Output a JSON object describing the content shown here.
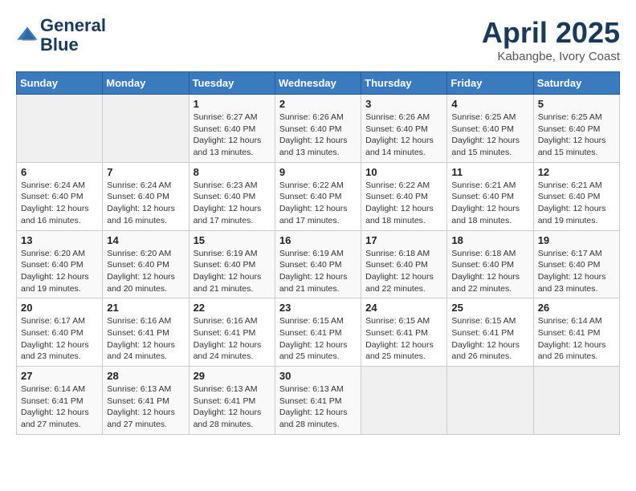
{
  "header": {
    "logo_line1": "General",
    "logo_line2": "Blue",
    "title": "April 2025",
    "subtitle": "Kabangbe, Ivory Coast"
  },
  "days_of_week": [
    "Sunday",
    "Monday",
    "Tuesday",
    "Wednesday",
    "Thursday",
    "Friday",
    "Saturday"
  ],
  "weeks": [
    [
      {
        "day": "",
        "sunrise": "",
        "sunset": "",
        "daylight": ""
      },
      {
        "day": "",
        "sunrise": "",
        "sunset": "",
        "daylight": ""
      },
      {
        "day": "1",
        "sunrise": "Sunrise: 6:27 AM",
        "sunset": "Sunset: 6:40 PM",
        "daylight": "Daylight: 12 hours and 13 minutes."
      },
      {
        "day": "2",
        "sunrise": "Sunrise: 6:26 AM",
        "sunset": "Sunset: 6:40 PM",
        "daylight": "Daylight: 12 hours and 13 minutes."
      },
      {
        "day": "3",
        "sunrise": "Sunrise: 6:26 AM",
        "sunset": "Sunset: 6:40 PM",
        "daylight": "Daylight: 12 hours and 14 minutes."
      },
      {
        "day": "4",
        "sunrise": "Sunrise: 6:25 AM",
        "sunset": "Sunset: 6:40 PM",
        "daylight": "Daylight: 12 hours and 15 minutes."
      },
      {
        "day": "5",
        "sunrise": "Sunrise: 6:25 AM",
        "sunset": "Sunset: 6:40 PM",
        "daylight": "Daylight: 12 hours and 15 minutes."
      }
    ],
    [
      {
        "day": "6",
        "sunrise": "Sunrise: 6:24 AM",
        "sunset": "Sunset: 6:40 PM",
        "daylight": "Daylight: 12 hours and 16 minutes."
      },
      {
        "day": "7",
        "sunrise": "Sunrise: 6:24 AM",
        "sunset": "Sunset: 6:40 PM",
        "daylight": "Daylight: 12 hours and 16 minutes."
      },
      {
        "day": "8",
        "sunrise": "Sunrise: 6:23 AM",
        "sunset": "Sunset: 6:40 PM",
        "daylight": "Daylight: 12 hours and 17 minutes."
      },
      {
        "day": "9",
        "sunrise": "Sunrise: 6:22 AM",
        "sunset": "Sunset: 6:40 PM",
        "daylight": "Daylight: 12 hours and 17 minutes."
      },
      {
        "day": "10",
        "sunrise": "Sunrise: 6:22 AM",
        "sunset": "Sunset: 6:40 PM",
        "daylight": "Daylight: 12 hours and 18 minutes."
      },
      {
        "day": "11",
        "sunrise": "Sunrise: 6:21 AM",
        "sunset": "Sunset: 6:40 PM",
        "daylight": "Daylight: 12 hours and 18 minutes."
      },
      {
        "day": "12",
        "sunrise": "Sunrise: 6:21 AM",
        "sunset": "Sunset: 6:40 PM",
        "daylight": "Daylight: 12 hours and 19 minutes."
      }
    ],
    [
      {
        "day": "13",
        "sunrise": "Sunrise: 6:20 AM",
        "sunset": "Sunset: 6:40 PM",
        "daylight": "Daylight: 12 hours and 19 minutes."
      },
      {
        "day": "14",
        "sunrise": "Sunrise: 6:20 AM",
        "sunset": "Sunset: 6:40 PM",
        "daylight": "Daylight: 12 hours and 20 minutes."
      },
      {
        "day": "15",
        "sunrise": "Sunrise: 6:19 AM",
        "sunset": "Sunset: 6:40 PM",
        "daylight": "Daylight: 12 hours and 21 minutes."
      },
      {
        "day": "16",
        "sunrise": "Sunrise: 6:19 AM",
        "sunset": "Sunset: 6:40 PM",
        "daylight": "Daylight: 12 hours and 21 minutes."
      },
      {
        "day": "17",
        "sunrise": "Sunrise: 6:18 AM",
        "sunset": "Sunset: 6:40 PM",
        "daylight": "Daylight: 12 hours and 22 minutes."
      },
      {
        "day": "18",
        "sunrise": "Sunrise: 6:18 AM",
        "sunset": "Sunset: 6:40 PM",
        "daylight": "Daylight: 12 hours and 22 minutes."
      },
      {
        "day": "19",
        "sunrise": "Sunrise: 6:17 AM",
        "sunset": "Sunset: 6:40 PM",
        "daylight": "Daylight: 12 hours and 23 minutes."
      }
    ],
    [
      {
        "day": "20",
        "sunrise": "Sunrise: 6:17 AM",
        "sunset": "Sunset: 6:40 PM",
        "daylight": "Daylight: 12 hours and 23 minutes."
      },
      {
        "day": "21",
        "sunrise": "Sunrise: 6:16 AM",
        "sunset": "Sunset: 6:41 PM",
        "daylight": "Daylight: 12 hours and 24 minutes."
      },
      {
        "day": "22",
        "sunrise": "Sunrise: 6:16 AM",
        "sunset": "Sunset: 6:41 PM",
        "daylight": "Daylight: 12 hours and 24 minutes."
      },
      {
        "day": "23",
        "sunrise": "Sunrise: 6:15 AM",
        "sunset": "Sunset: 6:41 PM",
        "daylight": "Daylight: 12 hours and 25 minutes."
      },
      {
        "day": "24",
        "sunrise": "Sunrise: 6:15 AM",
        "sunset": "Sunset: 6:41 PM",
        "daylight": "Daylight: 12 hours and 25 minutes."
      },
      {
        "day": "25",
        "sunrise": "Sunrise: 6:15 AM",
        "sunset": "Sunset: 6:41 PM",
        "daylight": "Daylight: 12 hours and 26 minutes."
      },
      {
        "day": "26",
        "sunrise": "Sunrise: 6:14 AM",
        "sunset": "Sunset: 6:41 PM",
        "daylight": "Daylight: 12 hours and 26 minutes."
      }
    ],
    [
      {
        "day": "27",
        "sunrise": "Sunrise: 6:14 AM",
        "sunset": "Sunset: 6:41 PM",
        "daylight": "Daylight: 12 hours and 27 minutes."
      },
      {
        "day": "28",
        "sunrise": "Sunrise: 6:13 AM",
        "sunset": "Sunset: 6:41 PM",
        "daylight": "Daylight: 12 hours and 27 minutes."
      },
      {
        "day": "29",
        "sunrise": "Sunrise: 6:13 AM",
        "sunset": "Sunset: 6:41 PM",
        "daylight": "Daylight: 12 hours and 28 minutes."
      },
      {
        "day": "30",
        "sunrise": "Sunrise: 6:13 AM",
        "sunset": "Sunset: 6:41 PM",
        "daylight": "Daylight: 12 hours and 28 minutes."
      },
      {
        "day": "",
        "sunrise": "",
        "sunset": "",
        "daylight": ""
      },
      {
        "day": "",
        "sunrise": "",
        "sunset": "",
        "daylight": ""
      },
      {
        "day": "",
        "sunrise": "",
        "sunset": "",
        "daylight": ""
      }
    ]
  ]
}
